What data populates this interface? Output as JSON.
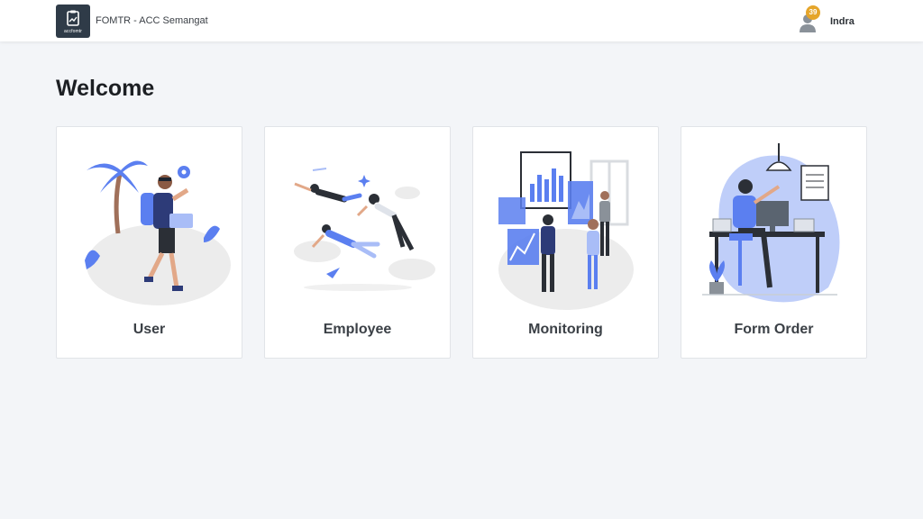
{
  "header": {
    "logo_text": "accfomtr",
    "app_title": "FOMTR - ACC Semangat",
    "notification_count": "39",
    "user_name": "Indra"
  },
  "main": {
    "heading": "Welcome",
    "cards": [
      {
        "label": "User",
        "illustration": "traveler-illustration"
      },
      {
        "label": "Employee",
        "illustration": "flying-people-illustration"
      },
      {
        "label": "Monitoring",
        "illustration": "dashboard-team-illustration"
      },
      {
        "label": "Form Order",
        "illustration": "desk-worker-illustration"
      }
    ]
  },
  "colors": {
    "accent_blue": "#5b7ff0",
    "light_blue": "#a9bdf7",
    "badge": "#e5a52a",
    "dark": "#2f3b48",
    "background": "#f3f5f8"
  }
}
